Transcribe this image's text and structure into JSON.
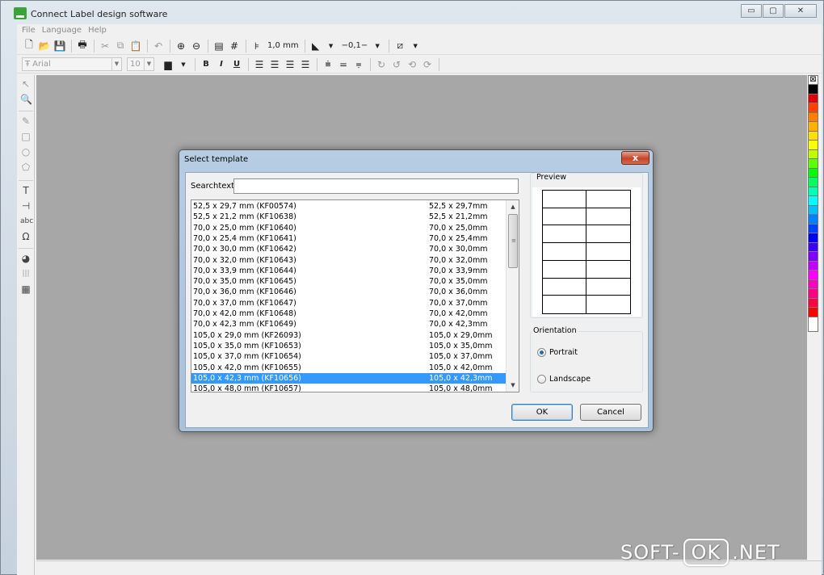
{
  "window": {
    "title": "Connect Label design software",
    "controls": {
      "minimize": "▭",
      "maximize": "▢",
      "close": "✕"
    }
  },
  "menubar": {
    "items": [
      "File",
      "Language",
      "Help"
    ]
  },
  "toolbar1": {
    "line_width": "1,0 mm",
    "line_style": "−0,1−"
  },
  "toolbar2": {
    "font_name": "Arial",
    "font_size": "10",
    "bold": "B",
    "italic": "I",
    "underline": "U"
  },
  "palette": {
    "colors": [
      "#000000",
      "#e00000",
      "#ff4000",
      "#ff8000",
      "#ffb000",
      "#ffe000",
      "#ffff00",
      "#c0ff00",
      "#60ff00",
      "#00ff00",
      "#00ff60",
      "#00ffb0",
      "#00ffff",
      "#00c0ff",
      "#0080ff",
      "#0040ff",
      "#0000ff",
      "#4000ff",
      "#8000ff",
      "#c000ff",
      "#ff00ff",
      "#ff00c0",
      "#ff0080",
      "#ff0040",
      "#ff0000"
    ]
  },
  "dialog": {
    "title": "Select template",
    "close_glyph": "x",
    "search_label": "Searchtext",
    "search_value": "",
    "templates": [
      {
        "name": "52,5 x 29,7 mm (KF00574)",
        "size": "52,5 x 29,7mm"
      },
      {
        "name": "52,5 x 21,2 mm (KF10638)",
        "size": "52,5 x 21,2mm"
      },
      {
        "name": "70,0 x 25,0 mm (KF10640)",
        "size": "70,0 x 25,0mm"
      },
      {
        "name": "70,0 x 25,4 mm (KF10641)",
        "size": "70,0 x 25,4mm"
      },
      {
        "name": "70,0 x 30,0 mm (KF10642)",
        "size": "70,0 x 30,0mm"
      },
      {
        "name": "70,0 x 32,0 mm (KF10643)",
        "size": "70,0 x 32,0mm"
      },
      {
        "name": "70,0 x 33,9 mm (KF10644)",
        "size": "70,0 x 33,9mm"
      },
      {
        "name": "70,0 x 35,0 mm (KF10645)",
        "size": "70,0 x 35,0mm"
      },
      {
        "name": "70,0 x 36,0 mm (KF10646)",
        "size": "70,0 x 36,0mm"
      },
      {
        "name": "70,0 x 37,0 mm (KF10647)",
        "size": "70,0 x 37,0mm"
      },
      {
        "name": "70,0 x 42,0 mm (KF10648)",
        "size": "70,0 x 42,0mm"
      },
      {
        "name": "70,0 x 42,3 mm (KF10649)",
        "size": "70,0 x 42,3mm"
      },
      {
        "name": "105,0 x 29,0 mm (KF26093)",
        "size": "105,0 x 29,0mm"
      },
      {
        "name": "105,0 x 35,0 mm (KF10653)",
        "size": "105,0 x 35,0mm"
      },
      {
        "name": "105,0 x 37,0 mm (KF10654)",
        "size": "105,0 x 37,0mm"
      },
      {
        "name": "105,0 x 42,0 mm (KF10655)",
        "size": "105,0 x 42,0mm"
      },
      {
        "name": "105,0 x 42,3 mm (KF10656)",
        "size": "105,0 x 42,3mm",
        "selected": true
      },
      {
        "name": "105,0 x 48,0 mm (KF10657)",
        "size": "105,0 x 48,0mm"
      }
    ],
    "preview_label": "Preview",
    "preview_grid": {
      "columns": 2,
      "rows": 7
    },
    "orientation_label": "Orientation",
    "orientation_options": [
      "Portrait",
      "Landscape"
    ],
    "orientation_selected": "Portrait",
    "ok_label": "OK",
    "cancel_label": "Cancel"
  },
  "watermark": {
    "left": "SOFT-",
    "box": "OK",
    "right": ".NET"
  }
}
